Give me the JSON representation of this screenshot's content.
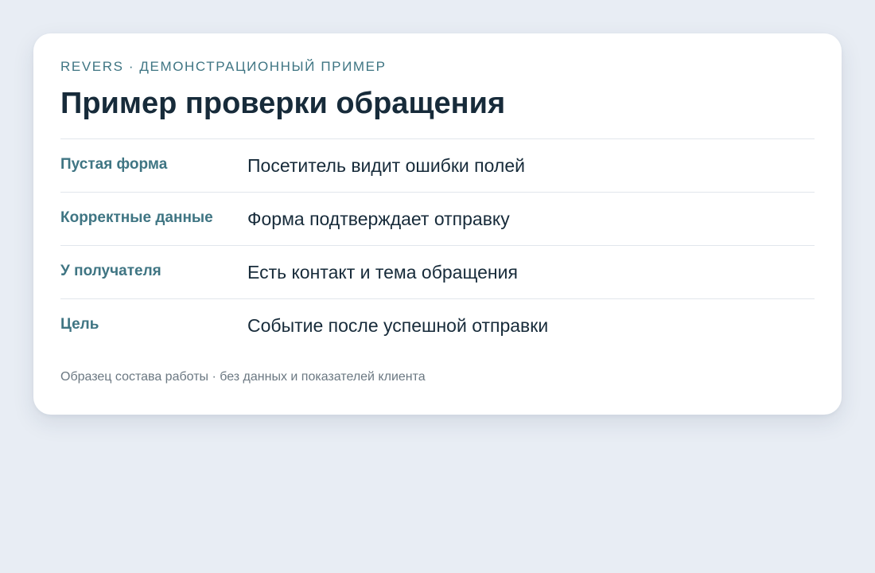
{
  "card": {
    "eyebrow": "REVERS · ДЕМОНСТРАЦИОННЫЙ ПРИМЕР",
    "title": "Пример проверки обращения",
    "rows": [
      {
        "label": "Пустая форма",
        "value": "Посетитель видит ошибки полей"
      },
      {
        "label": "Корректные данные",
        "value": "Форма подтверждает отправку"
      },
      {
        "label": "У получателя",
        "value": "Есть контакт и тема обращения"
      },
      {
        "label": "Цель",
        "value": "Событие после успешной отправки"
      }
    ],
    "footnote": "Образец состава работы · без данных и показателей клиента"
  },
  "colors": {
    "background": "#e8edf4",
    "card": "#ffffff",
    "accent": "#3f7583",
    "text": "#172b3a",
    "muted": "#6b7882",
    "divider": "#e1e6ec"
  }
}
